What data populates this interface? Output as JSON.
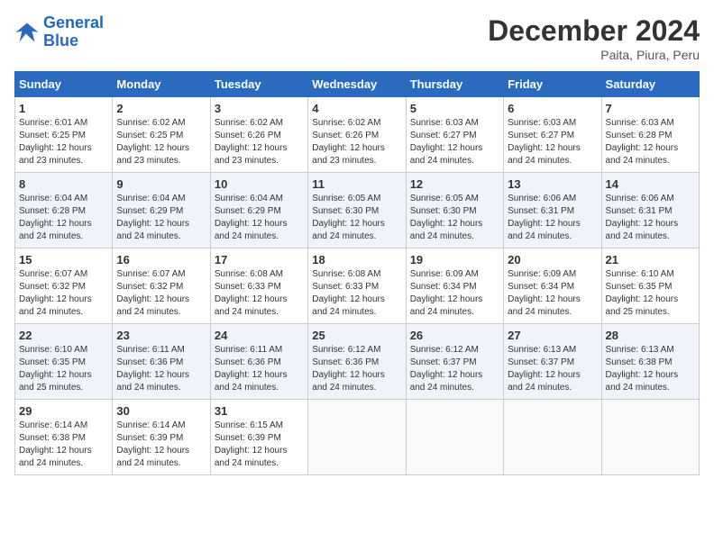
{
  "logo": {
    "line1": "General",
    "line2": "Blue"
  },
  "title": "December 2024",
  "subtitle": "Paita, Piura, Peru",
  "weekdays": [
    "Sunday",
    "Monday",
    "Tuesday",
    "Wednesday",
    "Thursday",
    "Friday",
    "Saturday"
  ],
  "weeks": [
    [
      {
        "day": "1",
        "sunrise": "6:01 AM",
        "sunset": "6:25 PM",
        "daylight": "12 hours and 23 minutes."
      },
      {
        "day": "2",
        "sunrise": "6:02 AM",
        "sunset": "6:25 PM",
        "daylight": "12 hours and 23 minutes."
      },
      {
        "day": "3",
        "sunrise": "6:02 AM",
        "sunset": "6:26 PM",
        "daylight": "12 hours and 23 minutes."
      },
      {
        "day": "4",
        "sunrise": "6:02 AM",
        "sunset": "6:26 PM",
        "daylight": "12 hours and 23 minutes."
      },
      {
        "day": "5",
        "sunrise": "6:03 AM",
        "sunset": "6:27 PM",
        "daylight": "12 hours and 24 minutes."
      },
      {
        "day": "6",
        "sunrise": "6:03 AM",
        "sunset": "6:27 PM",
        "daylight": "12 hours and 24 minutes."
      },
      {
        "day": "7",
        "sunrise": "6:03 AM",
        "sunset": "6:28 PM",
        "daylight": "12 hours and 24 minutes."
      }
    ],
    [
      {
        "day": "8",
        "sunrise": "6:04 AM",
        "sunset": "6:28 PM",
        "daylight": "12 hours and 24 minutes."
      },
      {
        "day": "9",
        "sunrise": "6:04 AM",
        "sunset": "6:29 PM",
        "daylight": "12 hours and 24 minutes."
      },
      {
        "day": "10",
        "sunrise": "6:04 AM",
        "sunset": "6:29 PM",
        "daylight": "12 hours and 24 minutes."
      },
      {
        "day": "11",
        "sunrise": "6:05 AM",
        "sunset": "6:30 PM",
        "daylight": "12 hours and 24 minutes."
      },
      {
        "day": "12",
        "sunrise": "6:05 AM",
        "sunset": "6:30 PM",
        "daylight": "12 hours and 24 minutes."
      },
      {
        "day": "13",
        "sunrise": "6:06 AM",
        "sunset": "6:31 PM",
        "daylight": "12 hours and 24 minutes."
      },
      {
        "day": "14",
        "sunrise": "6:06 AM",
        "sunset": "6:31 PM",
        "daylight": "12 hours and 24 minutes."
      }
    ],
    [
      {
        "day": "15",
        "sunrise": "6:07 AM",
        "sunset": "6:32 PM",
        "daylight": "12 hours and 24 minutes."
      },
      {
        "day": "16",
        "sunrise": "6:07 AM",
        "sunset": "6:32 PM",
        "daylight": "12 hours and 24 minutes."
      },
      {
        "day": "17",
        "sunrise": "6:08 AM",
        "sunset": "6:33 PM",
        "daylight": "12 hours and 24 minutes."
      },
      {
        "day": "18",
        "sunrise": "6:08 AM",
        "sunset": "6:33 PM",
        "daylight": "12 hours and 24 minutes."
      },
      {
        "day": "19",
        "sunrise": "6:09 AM",
        "sunset": "6:34 PM",
        "daylight": "12 hours and 24 minutes."
      },
      {
        "day": "20",
        "sunrise": "6:09 AM",
        "sunset": "6:34 PM",
        "daylight": "12 hours and 24 minutes."
      },
      {
        "day": "21",
        "sunrise": "6:10 AM",
        "sunset": "6:35 PM",
        "daylight": "12 hours and 25 minutes."
      }
    ],
    [
      {
        "day": "22",
        "sunrise": "6:10 AM",
        "sunset": "6:35 PM",
        "daylight": "12 hours and 25 minutes."
      },
      {
        "day": "23",
        "sunrise": "6:11 AM",
        "sunset": "6:36 PM",
        "daylight": "12 hours and 24 minutes."
      },
      {
        "day": "24",
        "sunrise": "6:11 AM",
        "sunset": "6:36 PM",
        "daylight": "12 hours and 24 minutes."
      },
      {
        "day": "25",
        "sunrise": "6:12 AM",
        "sunset": "6:36 PM",
        "daylight": "12 hours and 24 minutes."
      },
      {
        "day": "26",
        "sunrise": "6:12 AM",
        "sunset": "6:37 PM",
        "daylight": "12 hours and 24 minutes."
      },
      {
        "day": "27",
        "sunrise": "6:13 AM",
        "sunset": "6:37 PM",
        "daylight": "12 hours and 24 minutes."
      },
      {
        "day": "28",
        "sunrise": "6:13 AM",
        "sunset": "6:38 PM",
        "daylight": "12 hours and 24 minutes."
      }
    ],
    [
      {
        "day": "29",
        "sunrise": "6:14 AM",
        "sunset": "6:38 PM",
        "daylight": "12 hours and 24 minutes."
      },
      {
        "day": "30",
        "sunrise": "6:14 AM",
        "sunset": "6:39 PM",
        "daylight": "12 hours and 24 minutes."
      },
      {
        "day": "31",
        "sunrise": "6:15 AM",
        "sunset": "6:39 PM",
        "daylight": "12 hours and 24 minutes."
      },
      null,
      null,
      null,
      null
    ]
  ],
  "labels": {
    "sunrise": "Sunrise:",
    "sunset": "Sunset:",
    "daylight": "Daylight:"
  }
}
